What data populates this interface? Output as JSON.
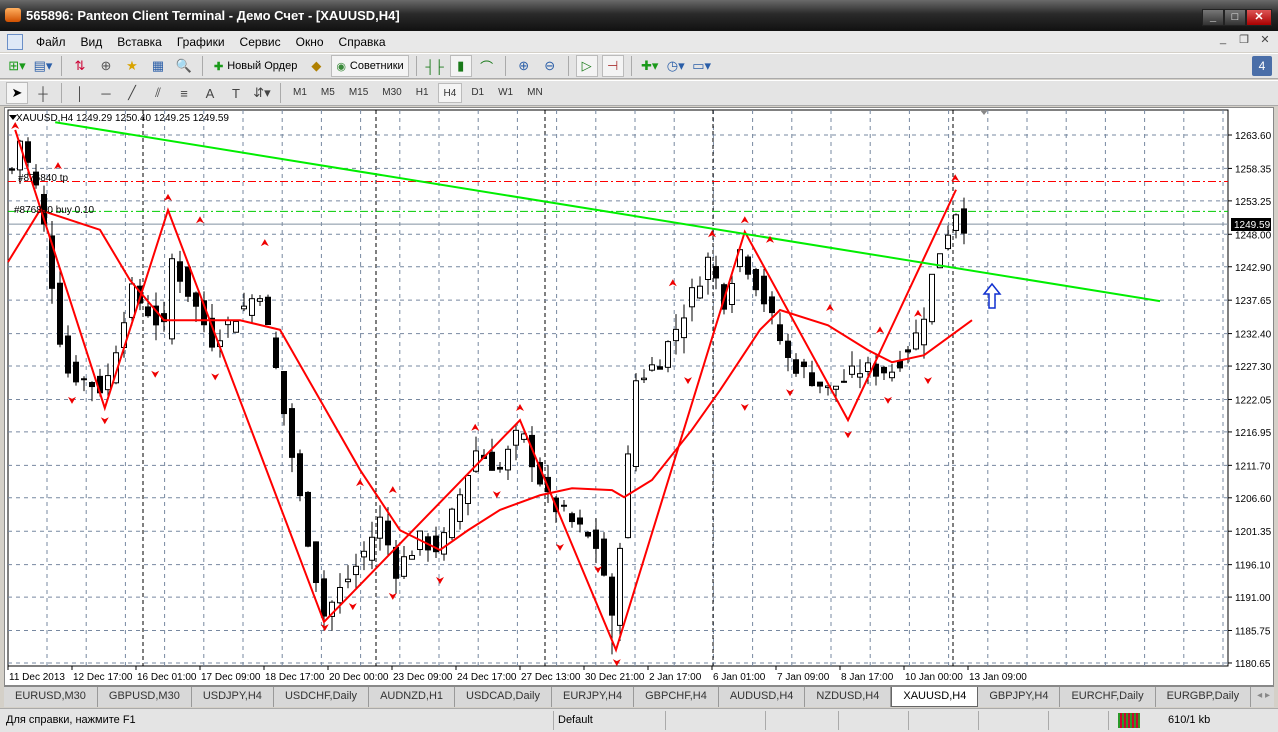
{
  "window": {
    "title": "565896: Panteon Client Terminal - Демо Счет - [XAUUSD,H4]"
  },
  "menu": [
    "Файл",
    "Вид",
    "Вставка",
    "Графики",
    "Сервис",
    "Окно",
    "Справка"
  ],
  "toolbar": {
    "new_order": "Новый Ордер",
    "experts": "Советники",
    "notifications": "4"
  },
  "timeframes": [
    "M1",
    "M5",
    "M15",
    "M30",
    "H1",
    "H4",
    "D1",
    "W1",
    "MN"
  ],
  "active_timeframe": "H4",
  "chart": {
    "header": "XAUUSD,H4  1249.29 1250.40 1249.25 1249.59",
    "tp_label": "#876840 tp",
    "order_label": "#876840 buy 0.10",
    "current_price": "1249.59",
    "colors": {
      "bull": "#ffffff",
      "bear": "#000000",
      "zigzag": "#ff0000",
      "ma": "#ff0000",
      "trendline": "#00ee00",
      "tp_line": "#ff0000",
      "order_line": "#00cc00"
    }
  },
  "chart_data": {
    "type": "candlestick",
    "symbol": "XAUUSD",
    "timeframe": "H4",
    "ylim": [
      1180.65,
      1263.6
    ],
    "price_ticks": [
      "1263.60",
      "1258.35",
      "1253.25",
      "1248.00",
      "1242.90",
      "1237.65",
      "1232.40",
      "1227.30",
      "1222.05",
      "1216.95",
      "1211.70",
      "1206.60",
      "1201.35",
      "1196.10",
      "1191.00",
      "1185.75",
      "1180.65"
    ],
    "time_ticks": [
      "11 Dec 2013",
      "12 Dec 17:00",
      "16 Dec 01:00",
      "17 Dec 09:00",
      "18 Dec 17:00",
      "20 Dec 00:00",
      "23 Dec 09:00",
      "24 Dec 17:00",
      "27 Dec 13:00",
      "30 Dec 21:00",
      "2 Jan 17:00",
      "6 Jan 01:00",
      "7 Jan 09:00",
      "8 Jan 17:00",
      "10 Jan 00:00",
      "13 Jan 09:00"
    ],
    "bar_count": 120,
    "close_path": [
      [
        0,
        1258.1
      ],
      [
        1,
        1262.8
      ],
      [
        3.5,
        1253.4
      ],
      [
        6.6,
        1226.7
      ],
      [
        11.6,
        1223.5
      ],
      [
        14.75,
        1239.2
      ],
      [
        19,
        1233
      ],
      [
        20,
        1244
      ],
      [
        25,
        1231.4
      ],
      [
        31,
        1239.2
      ],
      [
        33,
        1226.7
      ],
      [
        36,
        1206.3
      ],
      [
        39,
        1188.2
      ],
      [
        43.5,
        1196.8
      ],
      [
        46,
        1203.1
      ],
      [
        48,
        1195.3
      ],
      [
        51,
        1200
      ],
      [
        53.5,
        1198.4
      ],
      [
        58,
        1214.1
      ],
      [
        61,
        1211
      ],
      [
        63.5,
        1217.3
      ],
      [
        67,
        1206.3
      ],
      [
        71,
        1201.5
      ],
      [
        73.5,
        1198.4
      ],
      [
        75,
        1187
      ],
      [
        76,
        1200
      ],
      [
        78,
        1225.1
      ],
      [
        81,
        1228.3
      ],
      [
        83.5,
        1234.5
      ],
      [
        87,
        1244
      ],
      [
        89,
        1237.7
      ],
      [
        91,
        1245.5
      ],
      [
        93.5,
        1239.2
      ],
      [
        97,
        1228.3
      ],
      [
        102,
        1223.5
      ],
      [
        106,
        1226.7
      ],
      [
        110,
        1226.7
      ],
      [
        113.5,
        1233
      ],
      [
        115.5,
        1244
      ],
      [
        118,
        1251.8
      ],
      [
        119,
        1249.59
      ]
    ],
    "zigzag": [
      [
        0.4,
        1264.4
      ],
      [
        11.6,
        1220.7
      ],
      [
        19.5,
        1251.8
      ],
      [
        39,
        1187.1
      ],
      [
        63.5,
        1218.8
      ],
      [
        75.5,
        1182.7
      ],
      [
        91.6,
        1248.4
      ],
      [
        104.5,
        1218.8
      ],
      [
        118,
        1255
      ]
    ],
    "moving_average": [
      [
        -0.5,
        1243.65
      ],
      [
        3.5,
        1251.8
      ],
      [
        11,
        1248.7
      ],
      [
        14.75,
        1240.8
      ],
      [
        19,
        1234.5
      ],
      [
        23.5,
        1234.5
      ],
      [
        28.5,
        1234.5
      ],
      [
        33.5,
        1233
      ],
      [
        38.5,
        1222
      ],
      [
        43.5,
        1211
      ],
      [
        48.5,
        1201.5
      ],
      [
        53.5,
        1198.4
      ],
      [
        57,
        1201.5
      ],
      [
        61,
        1204.7
      ],
      [
        66,
        1207
      ],
      [
        70,
        1208.1
      ],
      [
        75,
        1207.8
      ],
      [
        76.5,
        1206.7
      ],
      [
        80,
        1209.4
      ],
      [
        85,
        1217.3
      ],
      [
        88.5,
        1223.5
      ],
      [
        93.5,
        1233
      ],
      [
        96,
        1236.1
      ],
      [
        102,
        1233.7
      ],
      [
        107,
        1229.8
      ],
      [
        110,
        1227.9
      ],
      [
        114,
        1229
      ],
      [
        120,
        1234.5
      ]
    ],
    "fractals_up": [
      [
        0.4,
        1264.7
      ],
      [
        5.75,
        1258.4
      ],
      [
        19.5,
        1253.4
      ],
      [
        23.5,
        1249.9
      ],
      [
        31.6,
        1246.3
      ],
      [
        43.5,
        1208.6
      ],
      [
        47.6,
        1207.5
      ],
      [
        57.9,
        1217.3
      ],
      [
        63.5,
        1220.4
      ],
      [
        82.6,
        1240
      ],
      [
        87.5,
        1247.7
      ],
      [
        91.6,
        1249.9
      ],
      [
        94.75,
        1246.8
      ],
      [
        102.25,
        1236.1
      ],
      [
        108.5,
        1232.6
      ],
      [
        113.25,
        1235.2
      ],
      [
        117.9,
        1256.5
      ]
    ],
    "fractals_down": [
      [
        7.5,
        1222.3
      ],
      [
        11.6,
        1219.1
      ],
      [
        17.9,
        1226.4
      ],
      [
        25.4,
        1226
      ],
      [
        39.1,
        1186.6
      ],
      [
        42.6,
        1189.9
      ],
      [
        47.6,
        1191.5
      ],
      [
        53.5,
        1194
      ],
      [
        60.6,
        1207.5
      ],
      [
        68.5,
        1199.2
      ],
      [
        73.25,
        1195.7
      ],
      [
        75.6,
        1181.1
      ],
      [
        84.5,
        1225.4
      ],
      [
        91.6,
        1221.2
      ],
      [
        97.25,
        1223.5
      ],
      [
        104.5,
        1216.9
      ],
      [
        109.5,
        1222.3
      ],
      [
        114.5,
        1225.4
      ]
    ],
    "trendline": [
      [
        5.4,
        1265.6
      ],
      [
        143.5,
        1237.5
      ]
    ],
    "tp_level": 1256.3,
    "order_level": 1251.6,
    "bid_level": 1249.59
  },
  "tabs": [
    "EURUSD,M30",
    "GBPUSD,M30",
    "USDJPY,H4",
    "USDCHF,Daily",
    "AUDNZD,H1",
    "USDCAD,Daily",
    "EURJPY,H4",
    "GBPCHF,H4",
    "AUDUSD,H4",
    "NZDUSD,H4",
    "XAUUSD,H4",
    "GBPJPY,H4",
    "EURCHF,Daily",
    "EURGBP,Daily"
  ],
  "active_tab": "XAUUSD,H4",
  "status": {
    "help": "Для справки, нажмите F1",
    "profile": "Default",
    "traffic": "610/1 kb"
  }
}
